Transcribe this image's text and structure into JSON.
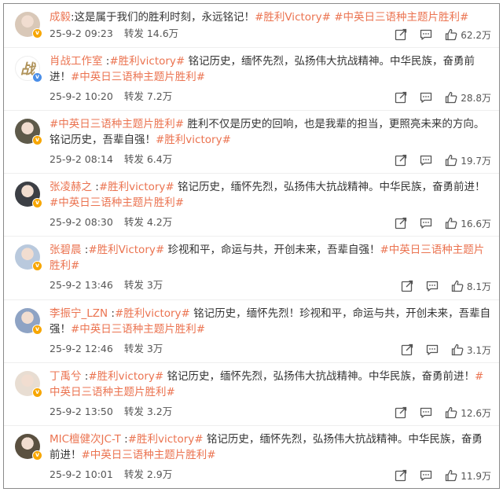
{
  "comments": [
    {
      "user": "成毅",
      "parts": [
        ":这是属于我们的胜利时刻，永远铭记！",
        "#胜利Victory#",
        " ",
        "#中英日三语种主题片胜利#"
      ],
      "tagIdx": [
        1,
        3
      ],
      "date": "25-9-2 09:23",
      "repost": "转发 14.6万",
      "likes": "62.2万",
      "badge": "gold",
      "avatarColor": "#d9c8b8"
    },
    {
      "user": "肖战工作室",
      "parts": [
        " :",
        "#胜利victory#",
        " 铭记历史，缅怀先烈，弘扬伟大抗战精神。中华民族，奋勇前进！",
        "#中英日三语种主题片胜利#"
      ],
      "tagIdx": [
        1,
        3
      ],
      "date": "25-9-2 10:20",
      "repost": "转发 7.2万",
      "likes": "28.8万",
      "badge": "blue",
      "avatarColor": "#ffffff",
      "avatarGlyph": "战"
    },
    {
      "user": "",
      "parts": [
        "#中英日三语种主题片胜利#",
        " 胜利不仅是历史的回响，也是我辈的担当，更照亮未来的方向。铭记历史，吾辈自强！",
        "#胜利victory#"
      ],
      "tagIdx": [
        0,
        2
      ],
      "date": "25-9-2 08:14",
      "repost": "转发 6.4万",
      "likes": "19.7万",
      "badge": "gold",
      "avatarColor": "#5e5a4a"
    },
    {
      "user": "张凌赫之",
      "parts": [
        " :",
        "#胜利victory#",
        " 铭记历史，缅怀先烈，弘扬伟大抗战精神。中华民族，奋勇前进！",
        "#中英日三语种主题片胜利#"
      ],
      "tagIdx": [
        1,
        3
      ],
      "date": "25-9-2 08:30",
      "repost": "转发 4.2万",
      "likes": "16.6万",
      "badge": "gold",
      "avatarColor": "#3c3f45"
    },
    {
      "user": "张碧晨",
      "parts": [
        " :",
        "#胜利Victory#",
        " 珍视和平，命运与共，开创未来，吾辈自强！",
        "#中英日三语种主题片胜利#"
      ],
      "tagIdx": [
        1,
        3
      ],
      "date": "25-9-2 13:46",
      "repost": "转发 3万",
      "likes": "8.1万",
      "badge": "gold",
      "avatarColor": "#b9c9dd"
    },
    {
      "user": "李振宁_LZN",
      "parts": [
        " :",
        "#胜利victory#",
        " 铭记历史，缅怀先烈！珍视和平，命运与共，开创未来，吾辈自强！",
        "#中英日三语种主题片胜利#"
      ],
      "tagIdx": [
        1,
        3
      ],
      "date": "25-9-2 12:46",
      "repost": "转发 3万",
      "likes": "3.1万",
      "badge": "gold",
      "avatarColor": "#8ea3c4"
    },
    {
      "user": "丁禹兮",
      "parts": [
        " :",
        "#胜利victory#",
        " 铭记历史，缅怀先烈，弘扬伟大抗战精神。中华民族，奋勇前进！",
        "#中英日三语种主题片胜利#"
      ],
      "tagIdx": [
        1,
        3
      ],
      "date": "25-9-2 13:50",
      "repost": "转发 3.2万",
      "likes": "12.6万",
      "badge": "gold",
      "avatarColor": "#e8ddd2"
    },
    {
      "user": "MIC檀健次JC-T",
      "parts": [
        " :",
        "#胜利victory#",
        " 铭记历史，缅怀先烈，弘扬伟大抗战精神。中华民族，奋勇前进！",
        "#中英日三语种主题片胜利#"
      ],
      "tagIdx": [
        1,
        3
      ],
      "date": "25-9-2 10:01",
      "repost": "转发 2.9万",
      "likes": "11.9万",
      "badge": "gold",
      "avatarColor": "#5a5040"
    }
  ],
  "colors": {
    "accent": "#eb7350",
    "text": "#333333",
    "meta": "#555555",
    "gold_badge": "#f7a600",
    "blue_badge": "#4a8ee8"
  },
  "icons": {
    "repost": "repost-icon",
    "comment": "comment-icon",
    "like": "thumbs-up-icon"
  }
}
